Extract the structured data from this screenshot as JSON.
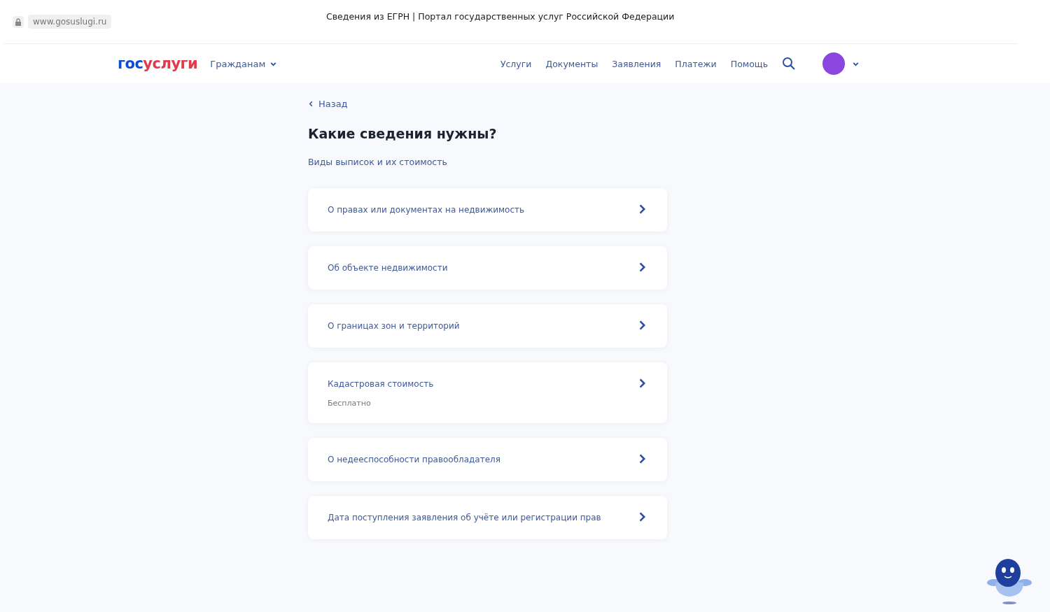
{
  "browser": {
    "url": "www.gosuslugi.ru",
    "title": "Сведения из ЕГРН | Портал государственных услуг Российской Федерации"
  },
  "header": {
    "logo": {
      "first": "гос",
      "second": "услуги"
    },
    "audience": "Гражданам",
    "nav": [
      "Услуги",
      "Документы",
      "Заявления",
      "Платежи",
      "Помощь"
    ]
  },
  "back": "Назад",
  "title": "Какие сведения нужны?",
  "info_link": "Виды выписок и их стоимость",
  "options": [
    {
      "label": "О правах или документах на недвижимость"
    },
    {
      "label": "Об объекте недвижимости"
    },
    {
      "label": "О границах зон и территорий"
    },
    {
      "label": "Кадастровая стоимость",
      "note": "Бесплатно"
    },
    {
      "label": "О недееспособности правообладателя"
    },
    {
      "label": "Дата поступления заявления об учёте или регистрации прав"
    }
  ]
}
